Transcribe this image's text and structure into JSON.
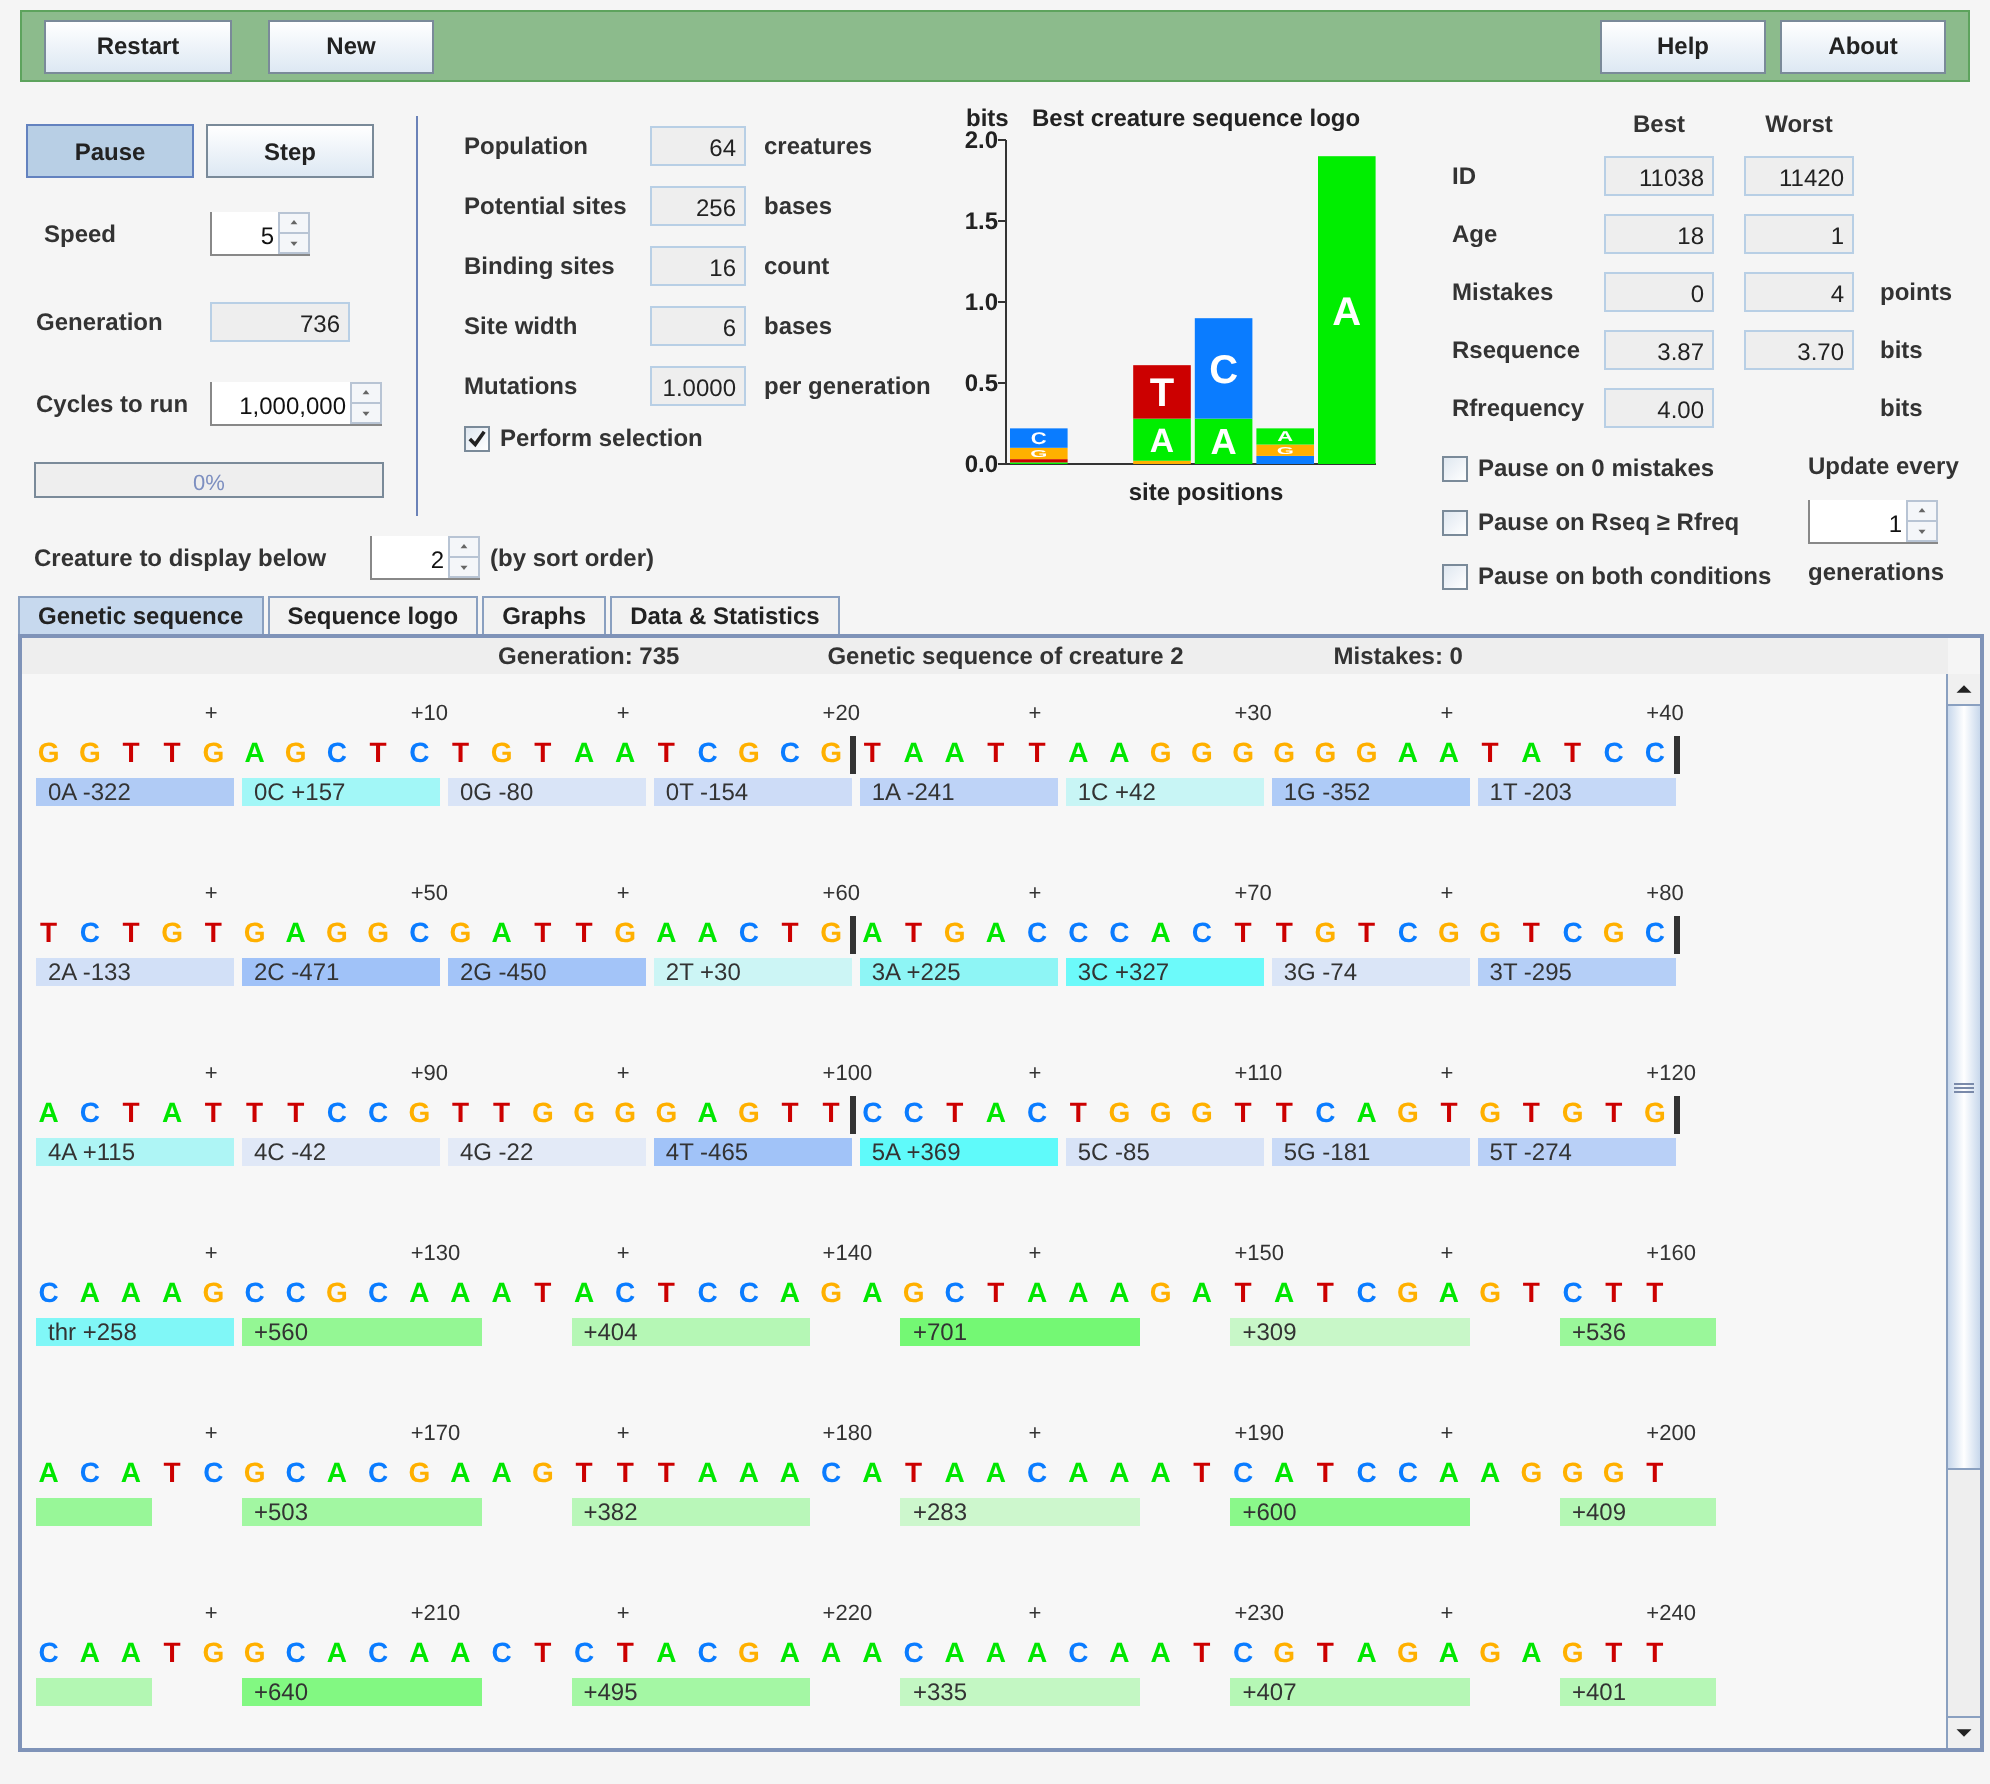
{
  "toolbar": {
    "left_buttons": [
      "Restart",
      "New"
    ],
    "right_buttons": [
      "Help",
      "About"
    ]
  },
  "run_controls": {
    "buttons": [
      {
        "label": "Pause",
        "selected": true
      },
      {
        "label": "Step",
        "selected": false
      }
    ],
    "speed": {
      "label": "Speed",
      "value": "5"
    },
    "generation": {
      "label": "Generation",
      "value": "736"
    },
    "cycles": {
      "label": "Cycles to run",
      "value": "1,000,000"
    },
    "progress": {
      "level": 0,
      "text": "0%"
    }
  },
  "parameters": [
    {
      "label": "Population",
      "value": "64",
      "unit": "creatures"
    },
    {
      "label": "Potential sites",
      "value": "256",
      "unit": "bases"
    },
    {
      "label": "Binding sites",
      "value": "16",
      "unit": "count"
    },
    {
      "label": "Site width",
      "value": "6",
      "unit": "bases"
    },
    {
      "label": "Mutations",
      "value": "1.0000",
      "unit": "per generation"
    }
  ],
  "perform_selection": {
    "label": "Perform selection",
    "checked": true
  },
  "logo": {
    "chart_data": {
      "type": "bar",
      "stacked": true,
      "title": "Best creature sequence logo",
      "ylabel": "bits",
      "xlabel": "site positions",
      "ylim": [
        0,
        2
      ],
      "yticks": [
        {
          "value": 0,
          "label": "0.0"
        },
        {
          "value": 0.5,
          "label": "0.5"
        },
        {
          "value": 1,
          "label": "1.0"
        },
        {
          "value": 1.5,
          "label": "1.5"
        },
        {
          "value": 2,
          "label": "2.0"
        }
      ],
      "series": [
        {
          "name": "A",
          "color": "#00ee00",
          "values": [
            0.01,
            null,
            0.26,
            0.28,
            0.1,
            1.9
          ]
        },
        {
          "name": "C",
          "color": "#0a7cff",
          "values": [
            0.12,
            null,
            null,
            0.62,
            0.05,
            null
          ]
        },
        {
          "name": "G",
          "color": "#ffb000",
          "values": [
            0.07,
            null,
            0.02,
            null,
            0.07,
            null
          ]
        },
        {
          "name": "T",
          "color": "#cc0000",
          "values": [
            0.02,
            null,
            0.33,
            null,
            null,
            null
          ]
        }
      ]
    }
  },
  "stats": {
    "columns": [
      "Best",
      "Worst"
    ],
    "rows": [
      {
        "label": "ID",
        "best": "11038",
        "worst": "11420"
      },
      {
        "label": "Age",
        "best": "18",
        "worst": "1"
      },
      {
        "label": "Mistakes",
        "best": "0",
        "worst": "4",
        "unit": "points"
      },
      {
        "label": "Rsequence",
        "best": "3.87",
        "worst": "3.70",
        "unit": "bits"
      },
      {
        "label": "Rfrequency",
        "best": "4.00",
        "unit": "bits"
      }
    ]
  },
  "pause_options": [
    {
      "label": "Pause on 0 mistakes",
      "checked": false
    },
    {
      "label": "Pause on Rseq ≥ Rfreq",
      "checked": false
    },
    {
      "label": "Pause on both conditions",
      "checked": false
    }
  ],
  "update": {
    "label": "Update every",
    "value": "1",
    "unit": "generations"
  },
  "creature_display": {
    "label": "Creature to display below",
    "value": "2",
    "note": "(by sort order)"
  },
  "tabs": [
    {
      "label": "Genetic sequence",
      "selected": true
    },
    {
      "label": "Sequence logo",
      "selected": false
    },
    {
      "label": "Graphs",
      "selected": false
    },
    {
      "label": "Data & Statistics",
      "selected": false
    }
  ],
  "sequence_panel": {
    "header": [
      "Generation: 735",
      "Genetic sequence of creature 2",
      "Mistakes: 0"
    ],
    "rows": [
      {
        "ticks": [
          "+",
          "+10",
          "+",
          "+20",
          "+",
          "+30",
          "+",
          "+40"
        ],
        "site_marks": true,
        "bases": [
          {
            "base": "G",
            "color": "#ffb000"
          },
          {
            "base": "G",
            "color": "#ffb000"
          },
          {
            "base": "T",
            "color": "#cc0000"
          },
          {
            "base": "T",
            "color": "#cc0000"
          },
          {
            "base": "G",
            "color": "#ffb000"
          },
          {
            "base": "A",
            "color": "#00e600"
          },
          {
            "base": "G",
            "color": "#ffb000"
          },
          {
            "base": "C",
            "color": "#0a7cff"
          },
          {
            "base": "T",
            "color": "#cc0000"
          },
          {
            "base": "C",
            "color": "#0a7cff"
          },
          {
            "base": "T",
            "color": "#cc0000"
          },
          {
            "base": "G",
            "color": "#ffb000"
          },
          {
            "base": "T",
            "color": "#cc0000"
          },
          {
            "base": "A",
            "color": "#00e600"
          },
          {
            "base": "A",
            "color": "#00e600"
          },
          {
            "base": "T",
            "color": "#cc0000"
          },
          {
            "base": "C",
            "color": "#0a7cff"
          },
          {
            "base": "G",
            "color": "#ffb000"
          },
          {
            "base": "C",
            "color": "#0a7cff"
          },
          {
            "base": "G",
            "color": "#ffb000"
          },
          {
            "base": "T",
            "color": "#cc0000"
          },
          {
            "base": "A",
            "color": "#00e600"
          },
          {
            "base": "A",
            "color": "#00e600"
          },
          {
            "base": "T",
            "color": "#cc0000"
          },
          {
            "base": "T",
            "color": "#cc0000"
          },
          {
            "base": "A",
            "color": "#00e600"
          },
          {
            "base": "A",
            "color": "#00e600"
          },
          {
            "base": "G",
            "color": "#ffb000"
          },
          {
            "base": "G",
            "color": "#ffb000"
          },
          {
            "base": "G",
            "color": "#ffb000"
          },
          {
            "base": "G",
            "color": "#ffb000"
          },
          {
            "base": "G",
            "color": "#ffb000"
          },
          {
            "base": "G",
            "color": "#ffb000"
          },
          {
            "base": "A",
            "color": "#00e600"
          },
          {
            "base": "A",
            "color": "#00e600"
          },
          {
            "base": "T",
            "color": "#cc0000"
          },
          {
            "base": "A",
            "color": "#00e600"
          },
          {
            "base": "T",
            "color": "#cc0000"
          },
          {
            "base": "C",
            "color": "#0a7cff"
          },
          {
            "base": "C",
            "color": "#0a7cff"
          }
        ],
        "bars": [
          {
            "kind": "weight",
            "text": "0A -322",
            "color": "#b0cbf5"
          },
          {
            "kind": "weight",
            "text": "0C +157",
            "color": "#a2f7f7"
          },
          {
            "kind": "weight",
            "text": "0G -80",
            "color": "#d9e4f7"
          },
          {
            "kind": "weight",
            "text": "0T -154",
            "color": "#cddcf7"
          },
          {
            "kind": "weight",
            "text": "1A -241",
            "color": "#bed3f7"
          },
          {
            "kind": "weight",
            "text": "1C +42",
            "color": "#c8f5f5"
          },
          {
            "kind": "weight",
            "text": "1G -352",
            "color": "#aecbf7"
          },
          {
            "kind": "weight",
            "text": "1T -203",
            "color": "#c5d8f7"
          }
        ]
      },
      {
        "ticks": [
          "+",
          "+50",
          "+",
          "+60",
          "+",
          "+70",
          "+",
          "+80"
        ],
        "site_marks": true,
        "bases": [
          {
            "base": "T",
            "color": "#cc0000"
          },
          {
            "base": "C",
            "color": "#0a7cff"
          },
          {
            "base": "T",
            "color": "#cc0000"
          },
          {
            "base": "G",
            "color": "#ffb000"
          },
          {
            "base": "T",
            "color": "#cc0000"
          },
          {
            "base": "G",
            "color": "#ffb000"
          },
          {
            "base": "A",
            "color": "#00e600"
          },
          {
            "base": "G",
            "color": "#ffb000"
          },
          {
            "base": "G",
            "color": "#ffb000"
          },
          {
            "base": "C",
            "color": "#0a7cff"
          },
          {
            "base": "G",
            "color": "#ffb000"
          },
          {
            "base": "A",
            "color": "#00e600"
          },
          {
            "base": "T",
            "color": "#cc0000"
          },
          {
            "base": "T",
            "color": "#cc0000"
          },
          {
            "base": "G",
            "color": "#ffb000"
          },
          {
            "base": "A",
            "color": "#00e600"
          },
          {
            "base": "A",
            "color": "#00e600"
          },
          {
            "base": "C",
            "color": "#0a7cff"
          },
          {
            "base": "T",
            "color": "#cc0000"
          },
          {
            "base": "G",
            "color": "#ffb000"
          },
          {
            "base": "A",
            "color": "#00e600"
          },
          {
            "base": "T",
            "color": "#cc0000"
          },
          {
            "base": "G",
            "color": "#ffb000"
          },
          {
            "base": "A",
            "color": "#00e600"
          },
          {
            "base": "C",
            "color": "#0a7cff"
          },
          {
            "base": "C",
            "color": "#0a7cff"
          },
          {
            "base": "C",
            "color": "#0a7cff"
          },
          {
            "base": "A",
            "color": "#00e600"
          },
          {
            "base": "C",
            "color": "#0a7cff"
          },
          {
            "base": "T",
            "color": "#cc0000"
          },
          {
            "base": "T",
            "color": "#cc0000"
          },
          {
            "base": "G",
            "color": "#ffb000"
          },
          {
            "base": "T",
            "color": "#cc0000"
          },
          {
            "base": "C",
            "color": "#0a7cff"
          },
          {
            "base": "G",
            "color": "#ffb000"
          },
          {
            "base": "G",
            "color": "#ffb000"
          },
          {
            "base": "T",
            "color": "#cc0000"
          },
          {
            "base": "C",
            "color": "#0a7cff"
          },
          {
            "base": "G",
            "color": "#ffb000"
          },
          {
            "base": "C",
            "color": "#0a7cff"
          }
        ],
        "bars": [
          {
            "kind": "weight",
            "text": "2A -133",
            "color": "#d2e0f7"
          },
          {
            "kind": "weight",
            "text": "2C -471",
            "color": "#a0c2f8"
          },
          {
            "kind": "weight",
            "text": "2G -450",
            "color": "#a3c4f8"
          },
          {
            "kind": "weight",
            "text": "2T +30",
            "color": "#ccf5f5"
          },
          {
            "kind": "weight",
            "text": "3A +225",
            "color": "#8ef5f5"
          },
          {
            "kind": "weight",
            "text": "3C +327",
            "color": "#6cfafa"
          },
          {
            "kind": "weight",
            "text": "3G -74",
            "color": "#dae5f7"
          },
          {
            "kind": "weight",
            "text": "3T -295",
            "color": "#b5cff7"
          }
        ]
      },
      {
        "ticks": [
          "+",
          "+90",
          "+",
          "+100",
          "+",
          "+110",
          "+",
          "+120"
        ],
        "site_marks": true,
        "bases": [
          {
            "base": "A",
            "color": "#00e600"
          },
          {
            "base": "C",
            "color": "#0a7cff"
          },
          {
            "base": "T",
            "color": "#cc0000"
          },
          {
            "base": "A",
            "color": "#00e600"
          },
          {
            "base": "T",
            "color": "#cc0000"
          },
          {
            "base": "T",
            "color": "#cc0000"
          },
          {
            "base": "T",
            "color": "#cc0000"
          },
          {
            "base": "C",
            "color": "#0a7cff"
          },
          {
            "base": "C",
            "color": "#0a7cff"
          },
          {
            "base": "G",
            "color": "#ffb000"
          },
          {
            "base": "T",
            "color": "#cc0000"
          },
          {
            "base": "T",
            "color": "#cc0000"
          },
          {
            "base": "G",
            "color": "#ffb000"
          },
          {
            "base": "G",
            "color": "#ffb000"
          },
          {
            "base": "G",
            "color": "#ffb000"
          },
          {
            "base": "G",
            "color": "#ffb000"
          },
          {
            "base": "A",
            "color": "#00e600"
          },
          {
            "base": "G",
            "color": "#ffb000"
          },
          {
            "base": "T",
            "color": "#cc0000"
          },
          {
            "base": "T",
            "color": "#cc0000"
          },
          {
            "base": "C",
            "color": "#0a7cff"
          },
          {
            "base": "C",
            "color": "#0a7cff"
          },
          {
            "base": "T",
            "color": "#cc0000"
          },
          {
            "base": "A",
            "color": "#00e600"
          },
          {
            "base": "C",
            "color": "#0a7cff"
          },
          {
            "base": "T",
            "color": "#cc0000"
          },
          {
            "base": "G",
            "color": "#ffb000"
          },
          {
            "base": "G",
            "color": "#ffb000"
          },
          {
            "base": "G",
            "color": "#ffb000"
          },
          {
            "base": "T",
            "color": "#cc0000"
          },
          {
            "base": "T",
            "color": "#cc0000"
          },
          {
            "base": "C",
            "color": "#0a7cff"
          },
          {
            "base": "A",
            "color": "#00e600"
          },
          {
            "base": "G",
            "color": "#ffb000"
          },
          {
            "base": "T",
            "color": "#cc0000"
          },
          {
            "base": "G",
            "color": "#ffb000"
          },
          {
            "base": "T",
            "color": "#cc0000"
          },
          {
            "base": "G",
            "color": "#ffb000"
          },
          {
            "base": "T",
            "color": "#cc0000"
          },
          {
            "base": "G",
            "color": "#ffb000"
          }
        ],
        "bars": [
          {
            "kind": "weight",
            "text": "4A +115",
            "color": "#aef5f5"
          },
          {
            "kind": "weight",
            "text": "4C -42",
            "color": "#e0e8f7"
          },
          {
            "kind": "weight",
            "text": "4G -22",
            "color": "#e3eaf7"
          },
          {
            "kind": "weight",
            "text": "4T -465",
            "color": "#a1c3f8"
          },
          {
            "kind": "weight",
            "text": "5A +369",
            "color": "#5ffafa"
          },
          {
            "kind": "weight",
            "text": "5C -85",
            "color": "#d8e3f7"
          },
          {
            "kind": "weight",
            "text": "5G -181",
            "color": "#c9daf7"
          },
          {
            "kind": "weight",
            "text": "5T -274",
            "color": "#b9d0f7"
          }
        ]
      },
      {
        "ticks": [
          "+",
          "+130",
          "+",
          "+140",
          "+",
          "+150",
          "+",
          "+160"
        ],
        "site_marks": false,
        "bases": [
          {
            "base": "C",
            "color": "#0a7cff"
          },
          {
            "base": "A",
            "color": "#00e600"
          },
          {
            "base": "A",
            "color": "#00e600"
          },
          {
            "base": "A",
            "color": "#00e600"
          },
          {
            "base": "G",
            "color": "#ffb000"
          },
          {
            "base": "C",
            "color": "#0a7cff"
          },
          {
            "base": "C",
            "color": "#0a7cff"
          },
          {
            "base": "G",
            "color": "#ffb000"
          },
          {
            "base": "C",
            "color": "#0a7cff"
          },
          {
            "base": "A",
            "color": "#00e600"
          },
          {
            "base": "A",
            "color": "#00e600"
          },
          {
            "base": "A",
            "color": "#00e600"
          },
          {
            "base": "T",
            "color": "#cc0000"
          },
          {
            "base": "A",
            "color": "#00e600"
          },
          {
            "base": "C",
            "color": "#0a7cff"
          },
          {
            "base": "T",
            "color": "#cc0000"
          },
          {
            "base": "C",
            "color": "#0a7cff"
          },
          {
            "base": "C",
            "color": "#0a7cff"
          },
          {
            "base": "A",
            "color": "#00e600"
          },
          {
            "base": "G",
            "color": "#ffb000"
          },
          {
            "base": "A",
            "color": "#00e600"
          },
          {
            "base": "G",
            "color": "#ffb000"
          },
          {
            "base": "C",
            "color": "#0a7cff"
          },
          {
            "base": "T",
            "color": "#cc0000"
          },
          {
            "base": "A",
            "color": "#00e600"
          },
          {
            "base": "A",
            "color": "#00e600"
          },
          {
            "base": "A",
            "color": "#00e600"
          },
          {
            "base": "G",
            "color": "#ffb000"
          },
          {
            "base": "A",
            "color": "#00e600"
          },
          {
            "base": "T",
            "color": "#cc0000"
          },
          {
            "base": "A",
            "color": "#00e600"
          },
          {
            "base": "T",
            "color": "#cc0000"
          },
          {
            "base": "C",
            "color": "#0a7cff"
          },
          {
            "base": "G",
            "color": "#ffb000"
          },
          {
            "base": "A",
            "color": "#00e600"
          },
          {
            "base": "G",
            "color": "#ffb000"
          },
          {
            "base": "T",
            "color": "#cc0000"
          },
          {
            "base": "C",
            "color": "#0a7cff"
          },
          {
            "base": "T",
            "color": "#cc0000"
          },
          {
            "base": "T",
            "color": "#cc0000"
          }
        ],
        "bars": [
          {
            "kind": "weight",
            "text": "thr +258",
            "color": "#80f7f7"
          },
          {
            "kind": "site",
            "text": "+560",
            "color": "#94f794"
          },
          {
            "kind": "site",
            "text": "+404",
            "color": "#b5f7b5"
          },
          {
            "kind": "site",
            "text": "+701",
            "color": "#74f874"
          },
          {
            "kind": "site",
            "text": "+309",
            "color": "#c8f7c8"
          },
          {
            "kind": "site",
            "text": "+536",
            "color": "#9af79a"
          }
        ]
      },
      {
        "ticks": [
          "+",
          "+170",
          "+",
          "+180",
          "+",
          "+190",
          "+",
          "+200"
        ],
        "site_marks": false,
        "bases": [
          {
            "base": "A",
            "color": "#00e600"
          },
          {
            "base": "C",
            "color": "#0a7cff"
          },
          {
            "base": "A",
            "color": "#00e600"
          },
          {
            "base": "T",
            "color": "#cc0000"
          },
          {
            "base": "C",
            "color": "#0a7cff"
          },
          {
            "base": "G",
            "color": "#ffb000"
          },
          {
            "base": "C",
            "color": "#0a7cff"
          },
          {
            "base": "A",
            "color": "#00e600"
          },
          {
            "base": "C",
            "color": "#0a7cff"
          },
          {
            "base": "G",
            "color": "#ffb000"
          },
          {
            "base": "A",
            "color": "#00e600"
          },
          {
            "base": "A",
            "color": "#00e600"
          },
          {
            "base": "G",
            "color": "#ffb000"
          },
          {
            "base": "T",
            "color": "#cc0000"
          },
          {
            "base": "T",
            "color": "#cc0000"
          },
          {
            "base": "T",
            "color": "#cc0000"
          },
          {
            "base": "A",
            "color": "#00e600"
          },
          {
            "base": "A",
            "color": "#00e600"
          },
          {
            "base": "A",
            "color": "#00e600"
          },
          {
            "base": "C",
            "color": "#0a7cff"
          },
          {
            "base": "A",
            "color": "#00e600"
          },
          {
            "base": "T",
            "color": "#cc0000"
          },
          {
            "base": "A",
            "color": "#00e600"
          },
          {
            "base": "A",
            "color": "#00e600"
          },
          {
            "base": "C",
            "color": "#0a7cff"
          },
          {
            "base": "A",
            "color": "#00e600"
          },
          {
            "base": "A",
            "color": "#00e600"
          },
          {
            "base": "A",
            "color": "#00e600"
          },
          {
            "base": "T",
            "color": "#cc0000"
          },
          {
            "base": "C",
            "color": "#0a7cff"
          },
          {
            "base": "A",
            "color": "#00e600"
          },
          {
            "base": "T",
            "color": "#cc0000"
          },
          {
            "base": "C",
            "color": "#0a7cff"
          },
          {
            "base": "C",
            "color": "#0a7cff"
          },
          {
            "base": "A",
            "color": "#00e600"
          },
          {
            "base": "A",
            "color": "#00e600"
          },
          {
            "base": "G",
            "color": "#ffb000"
          },
          {
            "base": "G",
            "color": "#ffb000"
          },
          {
            "base": "G",
            "color": "#ffb000"
          },
          {
            "base": "T",
            "color": "#cc0000"
          }
        ],
        "bars": [
          {
            "kind": "tail",
            "color": "#98f798"
          },
          {
            "kind": "site",
            "text": "+503",
            "color": "#a2f7a2"
          },
          {
            "kind": "site",
            "text": "+382",
            "color": "#b9f7b9"
          },
          {
            "kind": "site",
            "text": "+283",
            "color": "#cdf7cd"
          },
          {
            "kind": "site",
            "text": "+600",
            "color": "#8af88a"
          },
          {
            "kind": "site",
            "text": "+409",
            "color": "#b4f7b4"
          }
        ]
      },
      {
        "ticks": [
          "+",
          "+210",
          "+",
          "+220",
          "+",
          "+230",
          "+",
          "+240"
        ],
        "site_marks": false,
        "bases": [
          {
            "base": "C",
            "color": "#0a7cff"
          },
          {
            "base": "A",
            "color": "#00e600"
          },
          {
            "base": "A",
            "color": "#00e600"
          },
          {
            "base": "T",
            "color": "#cc0000"
          },
          {
            "base": "G",
            "color": "#ffb000"
          },
          {
            "base": "G",
            "color": "#ffb000"
          },
          {
            "base": "C",
            "color": "#0a7cff"
          },
          {
            "base": "A",
            "color": "#00e600"
          },
          {
            "base": "C",
            "color": "#0a7cff"
          },
          {
            "base": "A",
            "color": "#00e600"
          },
          {
            "base": "A",
            "color": "#00e600"
          },
          {
            "base": "C",
            "color": "#0a7cff"
          },
          {
            "base": "T",
            "color": "#cc0000"
          },
          {
            "base": "C",
            "color": "#0a7cff"
          },
          {
            "base": "T",
            "color": "#cc0000"
          },
          {
            "base": "A",
            "color": "#00e600"
          },
          {
            "base": "C",
            "color": "#0a7cff"
          },
          {
            "base": "G",
            "color": "#ffb000"
          },
          {
            "base": "A",
            "color": "#00e600"
          },
          {
            "base": "A",
            "color": "#00e600"
          },
          {
            "base": "A",
            "color": "#00e600"
          },
          {
            "base": "C",
            "color": "#0a7cff"
          },
          {
            "base": "A",
            "color": "#00e600"
          },
          {
            "base": "A",
            "color": "#00e600"
          },
          {
            "base": "A",
            "color": "#00e600"
          },
          {
            "base": "C",
            "color": "#0a7cff"
          },
          {
            "base": "A",
            "color": "#00e600"
          },
          {
            "base": "A",
            "color": "#00e600"
          },
          {
            "base": "T",
            "color": "#cc0000"
          },
          {
            "base": "C",
            "color": "#0a7cff"
          },
          {
            "base": "G",
            "color": "#ffb000"
          },
          {
            "base": "T",
            "color": "#cc0000"
          },
          {
            "base": "A",
            "color": "#00e600"
          },
          {
            "base": "G",
            "color": "#ffb000"
          },
          {
            "base": "A",
            "color": "#00e600"
          },
          {
            "base": "G",
            "color": "#ffb000"
          },
          {
            "base": "A",
            "color": "#00e600"
          },
          {
            "base": "G",
            "color": "#ffb000"
          },
          {
            "base": "T",
            "color": "#cc0000"
          },
          {
            "base": "T",
            "color": "#cc0000"
          }
        ],
        "bars": [
          {
            "kind": "tail",
            "color": "#b3f7b3"
          },
          {
            "kind": "site",
            "text": "+640",
            "color": "#82f882"
          },
          {
            "kind": "site",
            "text": "+495",
            "color": "#a4f7a4"
          },
          {
            "kind": "site",
            "text": "+335",
            "color": "#c3f7c3"
          },
          {
            "kind": "site",
            "text": "+407",
            "color": "#b5f7b5"
          },
          {
            "kind": "site",
            "text": "+401",
            "color": "#b6f7b6"
          }
        ]
      }
    ]
  }
}
